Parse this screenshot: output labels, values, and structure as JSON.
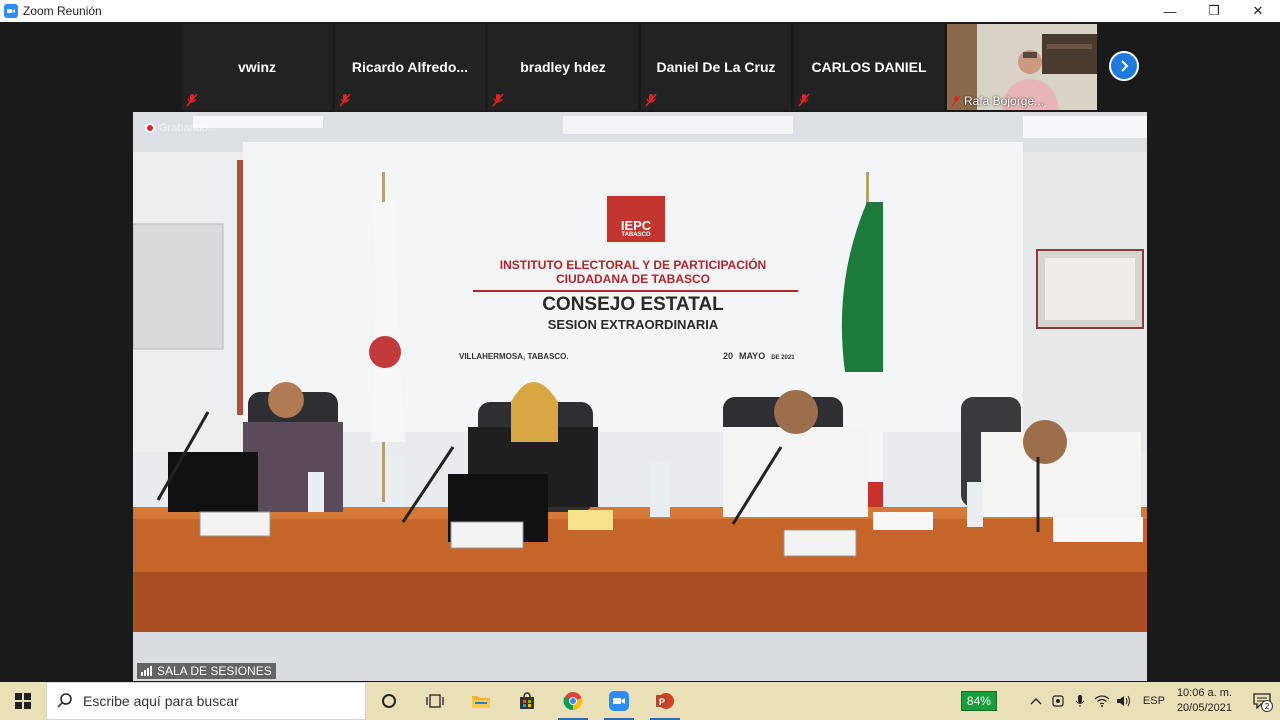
{
  "window": {
    "title": "Zoom Reunión",
    "minimize": "—",
    "maximize": "❐",
    "close": "✕"
  },
  "participants": [
    {
      "name": "vwinz",
      "muted": true
    },
    {
      "name": "Ricardo  Alfredo...",
      "muted": true
    },
    {
      "name": "bradley hdez",
      "muted": true
    },
    {
      "name": "Daniel De La Cruz",
      "muted": true
    },
    {
      "name": "CARLOS DANIEL",
      "muted": true
    }
  ],
  "video_participant": {
    "name": "Rafa Bojorge...",
    "muted": true
  },
  "main_video": {
    "recording_label": "Grabando...",
    "room_label": "SALA DE SESIONES",
    "sign": {
      "logo_text": "IEPC",
      "logo_sub": "TABASCO",
      "line1": "INSTITUTO ELECTORAL Y DE PARTICIPACIÓN",
      "line2": "CIUDADANA DE TABASCO",
      "line3": "CONSEJO ESTATAL",
      "line4": "SESION  EXTRAORDINARIA",
      "place": "VILLAHERMOSA, TABASCO.",
      "date_day": "20",
      "date_month": "MAYO",
      "date_year": "DE 2021"
    }
  },
  "taskbar": {
    "search_placeholder": "Escribe aquí para buscar",
    "battery": "84%",
    "language": "ESP",
    "time": "10:06 a. m.",
    "date": "20/05/2021",
    "notification_count": "2"
  }
}
